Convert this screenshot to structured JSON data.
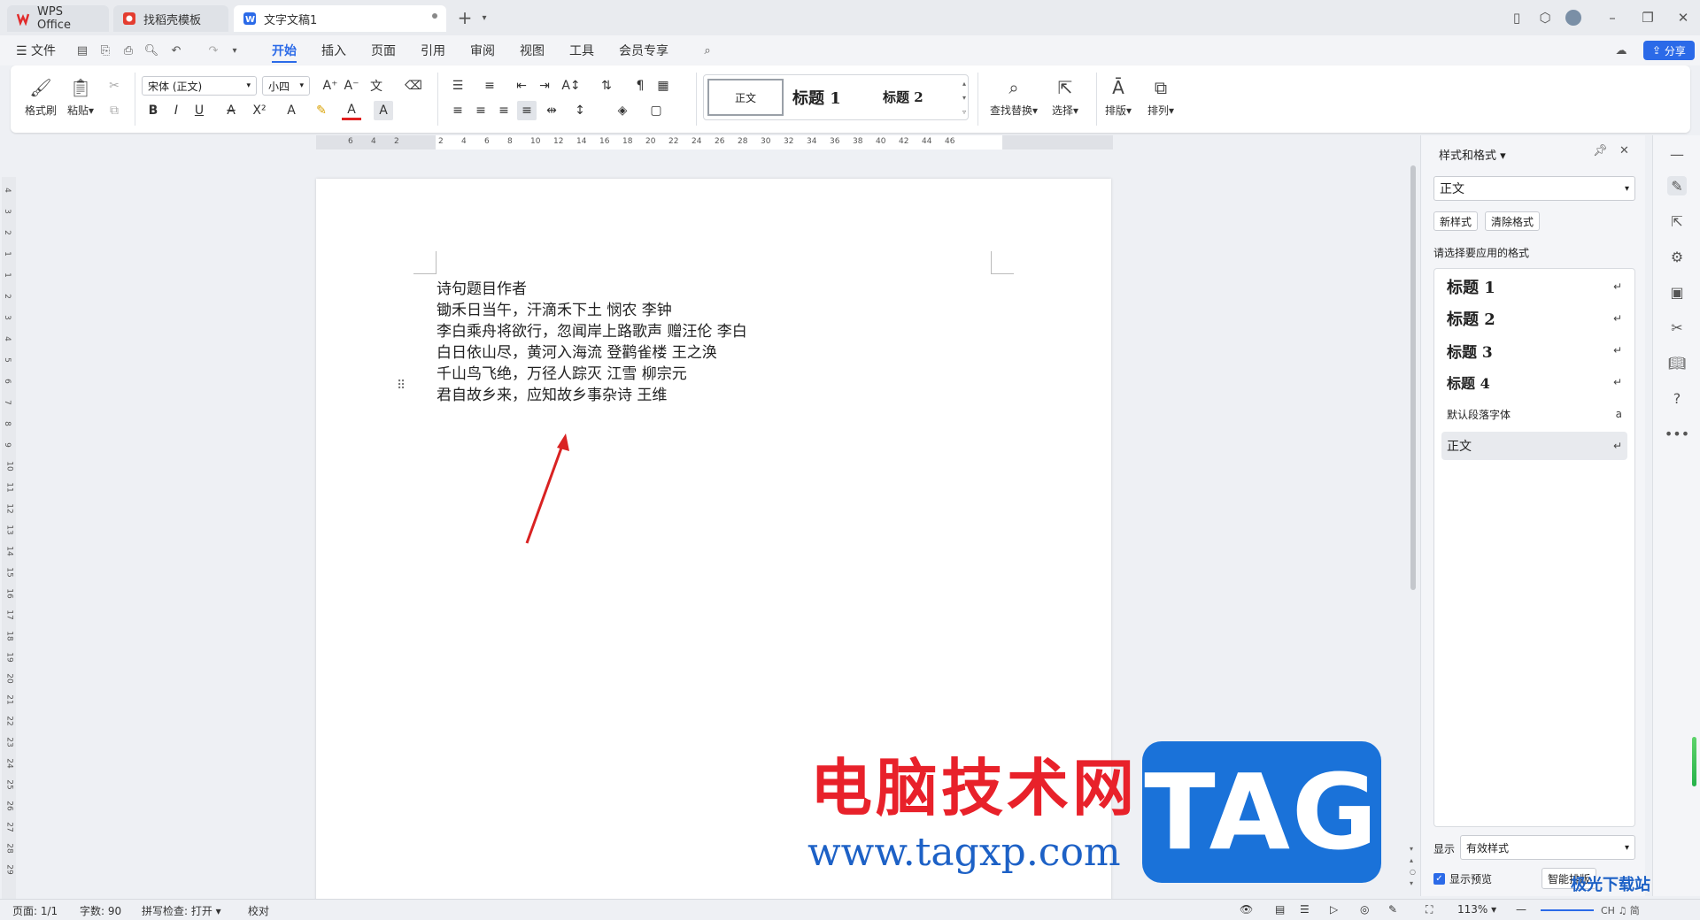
{
  "tabs": [
    {
      "label": "WPS Office",
      "icon": "wps-logo-icon"
    },
    {
      "label": "找稻壳模板",
      "icon": "daoke-icon"
    },
    {
      "label": "文字文稿1",
      "icon": "word-doc-icon"
    }
  ],
  "menubar": {
    "file": "文件",
    "items": [
      "开始",
      "插入",
      "页面",
      "引用",
      "审阅",
      "视图",
      "工具",
      "会员专享"
    ],
    "share": "分享"
  },
  "ribbon": {
    "format_painter": "格式刷",
    "paste": "粘贴",
    "font_name": "宋体 (正文)",
    "font_size": "小四",
    "bold": "B",
    "italic": "I",
    "underline": "U",
    "find_replace": "查找替换",
    "select": "选择",
    "layout": "排版",
    "arrange": "排列",
    "gallery": [
      "正文",
      "标题 1",
      "标题 2"
    ]
  },
  "ruler_h": [
    "6",
    "4",
    "2",
    "2",
    "4",
    "6",
    "8",
    "10",
    "12",
    "14",
    "16",
    "18",
    "20",
    "22",
    "24",
    "26",
    "28",
    "30",
    "32",
    "34",
    "36",
    "38",
    "40",
    "42",
    "44",
    "46"
  ],
  "ruler_v": [
    "4",
    "3",
    "2",
    "1",
    "1",
    "2",
    "3",
    "4",
    "5",
    "6",
    "7",
    "8",
    "9",
    "10",
    "11",
    "12",
    "13",
    "14",
    "15",
    "16",
    "17",
    "18",
    "19",
    "20",
    "21",
    "22",
    "23",
    "24",
    "25",
    "26",
    "27",
    "28",
    "29"
  ],
  "document": {
    "lines": [
      "诗句题目作者",
      "锄禾日当午，汗滴禾下土 悯农 李钟",
      "李白乘舟将欲行，忽闻岸上路歌声 赠汪伦 李白",
      "白日依山尽，黄河入海流 登鹳雀楼 王之涣",
      "千山鸟飞绝，万径人踪灭 江雪 柳宗元",
      "君自故乡来，应知故乡事杂诗 王维"
    ]
  },
  "panel": {
    "title": "样式和格式",
    "current_style": "正文",
    "new_style": "新样式",
    "clear_format": "清除格式",
    "prompt": "请选择要应用的格式",
    "styles": [
      {
        "label": "标题 1",
        "mark": "↵"
      },
      {
        "label": "标题 2",
        "mark": "↵"
      },
      {
        "label": "标题 3",
        "mark": "↵"
      },
      {
        "label": "标题 4",
        "mark": "↵"
      },
      {
        "label": "默认段落字体",
        "mark": "a"
      },
      {
        "label": "正文",
        "mark": "↵"
      }
    ],
    "show_label": "显示",
    "show_value": "有效样式",
    "preview_label": "显示预览",
    "smart_layout": "智能排版"
  },
  "status": {
    "page": "页面: 1/1",
    "words": "字数: 90",
    "spell": "拼写检查: 打开",
    "proof": "校对",
    "zoom": "113%",
    "ime": "CH ♫ 简"
  },
  "watermark": {
    "cn": "电脑技术网",
    "url": "www.tagxp.com",
    "tag": "TAG",
    "corner": "极光下载站"
  },
  "colors": {
    "accent": "#2b6ae8",
    "wm_red": "#e8212a",
    "wm_blue": "#1a72d9"
  }
}
